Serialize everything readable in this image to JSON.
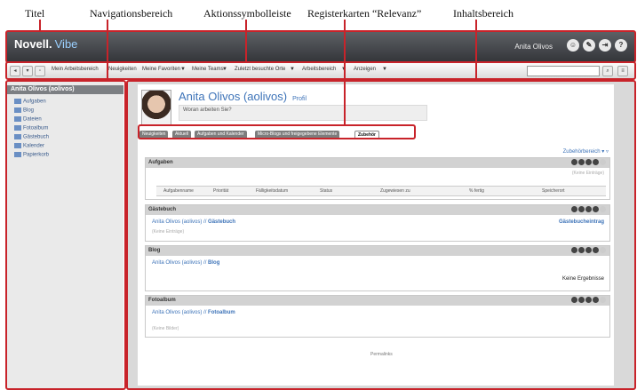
{
  "callouts": {
    "titel": "Titel",
    "navigation": "Navigationsbereich",
    "aktion": "Aktionssymbolleiste",
    "register": "Registerkarten “Relevanz”",
    "inhalt": "Inhaltsbereich"
  },
  "header": {
    "brand": "Novell.",
    "brand_suffix": "Vibe",
    "user": "Anita Olivos",
    "icons": [
      "person-icon",
      "pencil-icon",
      "logout-icon",
      "help-icon"
    ]
  },
  "toolbar": {
    "items": [
      "Mein Arbeitsbereich",
      "Neuigkeiten",
      "Meine Favoriten",
      "Meine Teams",
      "Zuletzt besuchte Orte",
      "Arbeitsbereich",
      "Anzeigen"
    ],
    "dropdown_marker": "▼"
  },
  "sidebar": {
    "title": "Anita Olivos (aolivos)",
    "items": [
      "Aufgaben",
      "Blog",
      "Dateien",
      "Fotoalbum",
      "Gästebuch",
      "Kalender",
      "Papierkorb"
    ]
  },
  "profile": {
    "name": "Anita Olivos (aolivos)",
    "profil_link": "Profil",
    "status_placeholder": "Woran arbeiten Sie?"
  },
  "tabs": [
    "Neuigkeiten",
    "Aktuell",
    "Aufgaben und Kalender",
    "Micro-Blogs und freigegebene Elemente",
    "Zubehör"
  ],
  "layout_link": "Zubehörbereich",
  "panels": {
    "aufgaben": {
      "title": "Aufgaben",
      "empty": "(Keine Einträge)",
      "columns": [
        "Aufgabenname",
        "Priorität",
        "Fälligkeitsdatum",
        "Status",
        "Zugewiesen zu",
        "% fertig",
        "Speicherort"
      ]
    },
    "gaestebuch": {
      "title": "Gästebuch",
      "owner": "Anita Olivos (aolivos)",
      "sep": "//",
      "target": "Gästebuch",
      "entry_link": "Gästebucheintrag",
      "empty": "(Keine Einträge)"
    },
    "blog": {
      "title": "Blog",
      "owner": "Anita Olivos (aolivos)",
      "sep": "//",
      "target": "Blog",
      "result": "Keine Ergebnisse"
    },
    "fotoalbum": {
      "title": "Fotoalbum",
      "owner": "Anita Olivos (aolivos)",
      "sep": "//",
      "target": "Fotoalbum",
      "empty": "(Keine Bilder)"
    }
  },
  "footer": {
    "permalink": "Permalinks"
  },
  "colors": {
    "accent": "#c8232a",
    "link": "#3d73b8",
    "header": "#3e4044"
  }
}
